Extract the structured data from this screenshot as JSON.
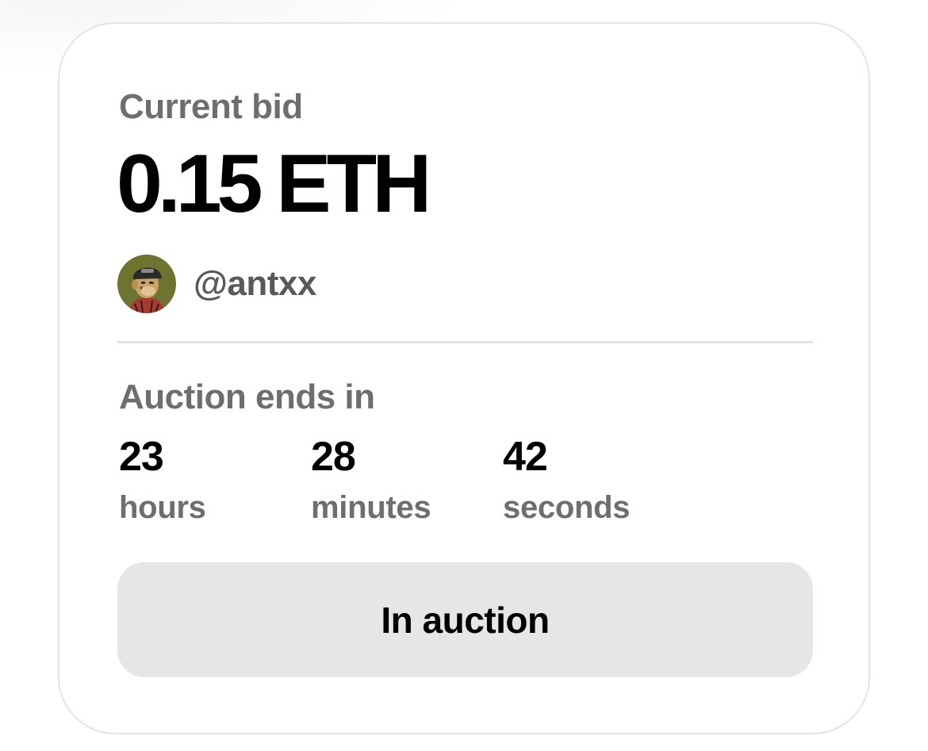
{
  "bid": {
    "label": "Current bid",
    "amount": "0.15 ETH"
  },
  "bidder": {
    "handle": "@antxx",
    "avatar_icon": "bored-ape-avatar-icon"
  },
  "auction": {
    "ends_label": "Auction ends in",
    "countdown": [
      {
        "value": "23",
        "unit": "hours"
      },
      {
        "value": "28",
        "unit": "minutes"
      },
      {
        "value": "42",
        "unit": "seconds"
      }
    ],
    "status_label": "In auction"
  },
  "colors": {
    "label_gray": "#6e6e6e",
    "button_bg": "#e6e6e6",
    "border": "#e4e4e4",
    "text": "#000000"
  }
}
